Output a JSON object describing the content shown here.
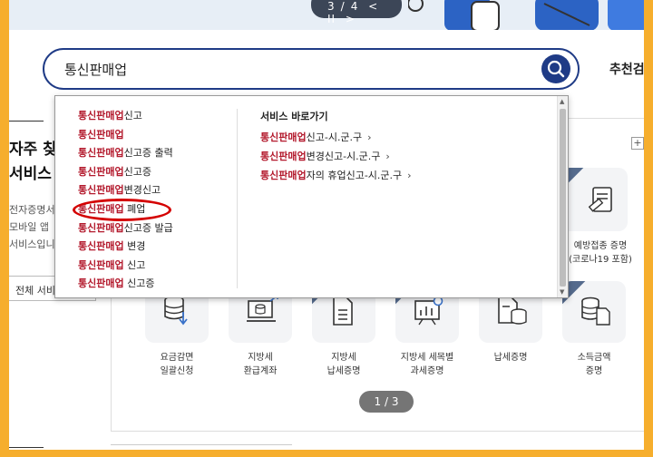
{
  "banner": {
    "pager": {
      "current": "3",
      "sep": "/",
      "total": "4",
      "prev": "<",
      "pause": "II",
      "next": ">"
    }
  },
  "search": {
    "value": "통신판매업",
    "placeholder": ""
  },
  "recommend_label": "추천검",
  "dropdown": {
    "suggestions": [
      {
        "hl": "통신판매업",
        "rest": "신고"
      },
      {
        "hl": "통신판매업",
        "rest": ""
      },
      {
        "hl": "통신판매업",
        "rest": "신고증 출력"
      },
      {
        "hl": "통신판매업",
        "rest": "신고증"
      },
      {
        "hl": "통신판매업",
        "rest": "변경신고"
      },
      {
        "hl": "통신판매업",
        "rest": " 폐업"
      },
      {
        "hl": "통신판매업",
        "rest": "신고증 발급"
      },
      {
        "hl": "통신판매업",
        "rest": " 변경"
      },
      {
        "hl": "통신판매업",
        "rest": " 신고"
      },
      {
        "hl": "통신판매업",
        "rest": " 신고증"
      }
    ],
    "quick_title": "서비스 바로가기",
    "quick_links": [
      {
        "hl": "통신판매업",
        "rest": "신고-시.군.구",
        "arrow": "›"
      },
      {
        "hl": "통신판매업",
        "rest": "변경신고-시.군.구",
        "arrow": "›"
      },
      {
        "hl": "통신판매업",
        "rest": "자의 휴업신고-시.군.구",
        "arrow": "›"
      }
    ]
  },
  "left": {
    "title_line1": "자주 찾",
    "title_line2": "서비스",
    "desc_line1": "전자증명서",
    "desc_line2": "모바일 앱",
    "desc_line3": "서비스입니",
    "all_button": "전체 서비"
  },
  "services": {
    "plus": "+",
    "top_tile_label1": "예방접종 증명",
    "top_tile_label2": "(코로나19 포함)",
    "tiles": [
      {
        "line1": "요금감면",
        "line2": "일괄신청"
      },
      {
        "line1": "지방세",
        "line2": "환급계좌"
      },
      {
        "line1": "지방세",
        "line2": "납세증명"
      },
      {
        "line1": "지방세 세목별",
        "line2": "과세증명"
      },
      {
        "line1": "납세증명",
        "line2": ""
      },
      {
        "line1": "소득금액",
        "line2": "증명"
      }
    ],
    "pager": "1 / 3"
  },
  "colors": {
    "accent_blue": "#1f3b86",
    "highlight_red": "#b3192c",
    "frame_orange": "#f6ae2d",
    "annotation_red": "#d40000"
  }
}
